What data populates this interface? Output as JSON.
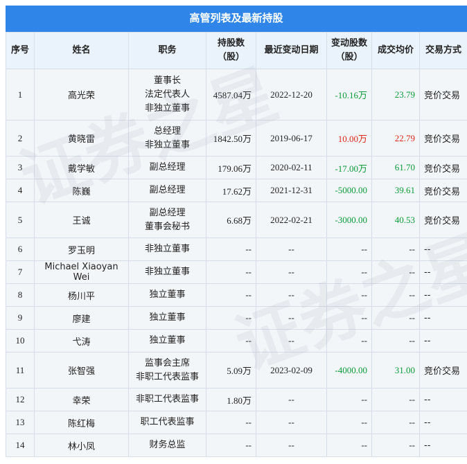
{
  "title": "高管列表及最新持股",
  "headers": {
    "seq": "序号",
    "name": "姓名",
    "position": "职务",
    "holding_line1": "持股数",
    "holding_line2": "（股）",
    "latest_date": "最近变动日期",
    "change_line1": "变动股数",
    "change_line2": "（股）",
    "avg_price": "成交均价",
    "method": "交易方式"
  },
  "rows": [
    {
      "seq": "1",
      "name": "高光荣",
      "positions": [
        "董事长",
        "法定代表人",
        "非独立董事"
      ],
      "holding": "4587.04万",
      "date": "2022-12-20",
      "change": "-10.16万",
      "change_dir": "neg",
      "price": "23.79",
      "price_dir": "green",
      "method": "竞价交易"
    },
    {
      "seq": "2",
      "name": "黄晓雷",
      "positions": [
        "总经理",
        "非独立董事"
      ],
      "holding": "1842.50万",
      "date": "2019-06-17",
      "change": "10.00万",
      "change_dir": "pos",
      "price": "22.79",
      "price_dir": "red",
      "method": "竞价交易"
    },
    {
      "seq": "3",
      "name": "戴学敏",
      "positions": [
        "副总经理"
      ],
      "holding": "179.06万",
      "date": "2020-02-11",
      "change": "-17.00万",
      "change_dir": "neg",
      "price": "61.70",
      "price_dir": "green",
      "method": "竞价交易"
    },
    {
      "seq": "4",
      "name": "陈巍",
      "positions": [
        "副总经理"
      ],
      "holding": "17.62万",
      "date": "2021-12-31",
      "change": "-5000.00",
      "change_dir": "neg",
      "price": "39.61",
      "price_dir": "green",
      "method": "竞价交易"
    },
    {
      "seq": "5",
      "name": "王诚",
      "positions": [
        "副总经理",
        "董事会秘书"
      ],
      "holding": "6.68万",
      "date": "2022-02-21",
      "change": "-3000.00",
      "change_dir": "neg",
      "price": "40.53",
      "price_dir": "green",
      "method": "竞价交易"
    },
    {
      "seq": "6",
      "name": "罗玉明",
      "positions": [
        "非独立董事"
      ],
      "holding": "--",
      "date": "--",
      "change": "--",
      "change_dir": "",
      "price": "--",
      "price_dir": "",
      "method": "--"
    },
    {
      "seq": "7",
      "name": "Michael Xiaoyan Wei",
      "positions": [
        "非独立董事"
      ],
      "holding": "--",
      "date": "--",
      "change": "--",
      "change_dir": "",
      "price": "--",
      "price_dir": "",
      "method": "--"
    },
    {
      "seq": "8",
      "name": "杨川平",
      "positions": [
        "独立董事"
      ],
      "holding": "--",
      "date": "--",
      "change": "--",
      "change_dir": "",
      "price": "--",
      "price_dir": "",
      "method": "--"
    },
    {
      "seq": "9",
      "name": "廖建",
      "positions": [
        "独立董事"
      ],
      "holding": "--",
      "date": "--",
      "change": "--",
      "change_dir": "",
      "price": "--",
      "price_dir": "",
      "method": "--"
    },
    {
      "seq": "10",
      "name": "弋涛",
      "positions": [
        "独立董事"
      ],
      "holding": "--",
      "date": "--",
      "change": "--",
      "change_dir": "",
      "price": "--",
      "price_dir": "",
      "method": "--"
    },
    {
      "seq": "11",
      "name": "张智强",
      "positions": [
        "监事会主席",
        "非职工代表监事"
      ],
      "holding": "5.09万",
      "date": "2023-02-09",
      "change": "-4000.00",
      "change_dir": "neg",
      "price": "31.00",
      "price_dir": "green",
      "method": "竞价交易"
    },
    {
      "seq": "12",
      "name": "幸荣",
      "positions": [
        "非职工代表监事"
      ],
      "holding": "1.80万",
      "date": "--",
      "change": "--",
      "change_dir": "",
      "price": "--",
      "price_dir": "",
      "method": "--"
    },
    {
      "seq": "13",
      "name": "陈红梅",
      "positions": [
        "职工代表监事"
      ],
      "holding": "--",
      "date": "--",
      "change": "--",
      "change_dir": "",
      "price": "--",
      "price_dir": "",
      "method": "--"
    },
    {
      "seq": "14",
      "name": "林小凤",
      "positions": [
        "财务总监"
      ],
      "holding": "--",
      "date": "--",
      "change": "--",
      "change_dir": "",
      "price": "--",
      "price_dir": "",
      "method": "--"
    }
  ]
}
